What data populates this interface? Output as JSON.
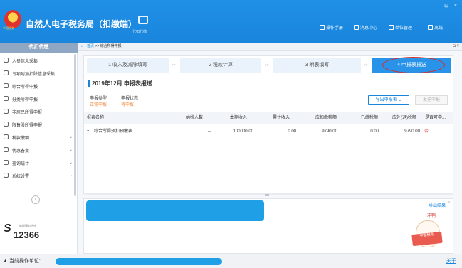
{
  "header": {
    "app_title": "自然人电子税务局（扣缴端）",
    "emblem_text": "中国税务",
    "device_label": "代扣代缴",
    "actions": [
      {
        "label": "操作手册",
        "icon": "book-icon"
      },
      {
        "label": "消息中心",
        "icon": "mail-icon"
      },
      {
        "label": "单位管理",
        "icon": "building-icon"
      },
      {
        "label": "离线",
        "icon": "offline-icon"
      }
    ],
    "window_controls": "– ⊡ ×"
  },
  "sidebar": {
    "title": "代扣代缴",
    "items": [
      {
        "label": "人员信息采集",
        "icon": "person-icon",
        "has_chevron": false
      },
      {
        "label": "专项附加扣除信息采集",
        "icon": "list-icon",
        "has_chevron": false
      },
      {
        "label": "综合所得申报",
        "icon": "layers-icon",
        "has_chevron": false
      },
      {
        "label": "分类所得申报",
        "icon": "clock-icon",
        "has_chevron": false
      },
      {
        "label": "非居民所得申报",
        "icon": "user-icon",
        "has_chevron": false
      },
      {
        "label": "限售股所得申报",
        "icon": "bar-chart-icon",
        "has_chevron": false
      },
      {
        "label": "税款缴纳",
        "icon": "folder-icon",
        "has_chevron": true
      },
      {
        "label": "优惠备案",
        "icon": "document-icon",
        "has_chevron": true
      },
      {
        "label": "查询统计",
        "icon": "search-icon",
        "has_chevron": true
      },
      {
        "label": "系统设置",
        "icon": "gear-icon",
        "has_chevron": true
      }
    ],
    "collapse_glyph": "‹",
    "hotline_label": "纳税服务热线",
    "hotline_number": "12366"
  },
  "breadcrumb": {
    "home": "首页",
    "sep": ">>",
    "current": "综合所得申报",
    "controls": "◘ ×"
  },
  "steps": [
    {
      "label": "1 收入及减除填写",
      "active": false
    },
    {
      "label": "2 税款计算",
      "active": false
    },
    {
      "label": "3 附表填写",
      "active": false
    },
    {
      "label": "4 申报表报送",
      "active": true
    }
  ],
  "step_arrow": ">>",
  "report": {
    "title": "2019年12月  申报表报送",
    "type_label": "申报类型",
    "type_value": "正常申报",
    "status_label": "申报状态",
    "status_value": "待申报",
    "export_button": "导出申报表",
    "send_button": "发送申报"
  },
  "table": {
    "columns": [
      "报表名称",
      "纳税人数",
      "本期收入",
      "累计收入",
      "应扣缴税额",
      "已缴税额",
      "应补(退)税额",
      "是否可申..."
    ],
    "rows": [
      {
        "expand": "+",
        "name": "综合所得预扣预缴表",
        "taxpayers": "--",
        "income": "100000.00",
        "cumulative": "0.00",
        "tax_payable": "9790.00",
        "tax_paid": "0.00",
        "tax_due": "9790.00",
        "can_file": "否"
      }
    ]
  },
  "bottom": {
    "detail_link": "导出结果",
    "mascot_text": "冲鸭",
    "mascot_sign": "中国税务"
  },
  "footer": {
    "label": "当前操作单位:",
    "about": "关于"
  }
}
